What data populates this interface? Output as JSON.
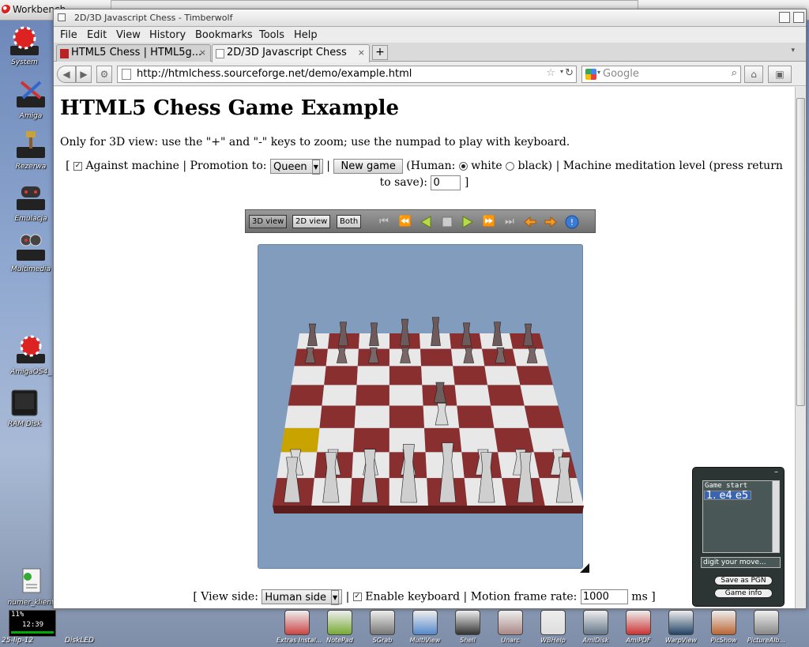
{
  "workbench": {
    "title": "Workbench",
    "ghost_window_title": "2D/3D Javascript Chess - Timberwolf"
  },
  "desktop_icons": [
    {
      "label": "System",
      "icon": "amiga-ball-drive-icon"
    },
    {
      "label": "Amiga",
      "icon": "tools-drive-icon"
    },
    {
      "label": "Rezerwa",
      "icon": "hammer-drive-icon"
    },
    {
      "label": "Emulacja",
      "icon": "gamepad-drive-icon"
    },
    {
      "label": "Multimedia",
      "icon": "film-drive-icon"
    },
    {
      "label": "AmigaOS4_",
      "icon": "amiga-ball-drive-icon"
    },
    {
      "label": "RAM Disk",
      "icon": "ram-disk-icon"
    },
    {
      "label": "numer_klient",
      "icon": "script-document-icon"
    }
  ],
  "browser": {
    "window_title": "2D/3D Javascript Chess - Timberwolf",
    "menu": [
      "File",
      "Edit",
      "View",
      "History",
      "Bookmarks",
      "Tools",
      "Help"
    ],
    "tabs": [
      {
        "label": "HTML5 Chess | HTML5g...",
        "active": false
      },
      {
        "label": "2D/3D Javascript Chess",
        "active": true
      }
    ],
    "new_tab_label": "+",
    "url": "http://htmlchess.sourceforge.net/demo/example.html",
    "search_placeholder": "Google",
    "search_engine_menu_glyph": "▾"
  },
  "page": {
    "heading": "HTML5 Chess Game Example",
    "intro": "Only for 3D view: use the \"+\" and \"-\" keys to zoom; use the numpad to play with keyboard.",
    "controls": {
      "open_bracket": "[",
      "against_machine_checked": true,
      "against_machine_label": "Against machine |",
      "promotion_label": "Promotion to:",
      "promotion_value": "Queen",
      "separator": "|",
      "new_game_label": "New game",
      "human_label": "(Human:",
      "white_label": "white",
      "white_selected": true,
      "black_label": "black) | Machine meditation level (press return to save):",
      "meditation_value": "0",
      "close_bracket": "]"
    },
    "toolbar": {
      "views": [
        "3D view",
        "2D view",
        "Both"
      ],
      "active_view": "3D view",
      "nav_icons": [
        "first-move-icon",
        "rewind-icon",
        "back-play-icon",
        "stop-icon",
        "play-icon",
        "fast-forward-icon",
        "last-move-icon",
        "undo-arrow-icon",
        "redo-arrow-icon",
        "info-icon"
      ]
    },
    "board": {
      "background_color": "#819cbd",
      "light_square": "#e8e8e8",
      "dark_square": "#8a2f2f",
      "highlight_square": "#c9a400",
      "last_move": "1. e4 e5"
    },
    "bottom": {
      "view_side_label": "[ View side:",
      "view_side_value": "Human side",
      "separator": "|",
      "enable_keyboard_checked": true,
      "enable_keyboard_label": "Enable keyboard | Motion frame rate:",
      "frame_rate_value": "1000",
      "frame_rate_unit": "ms ]"
    }
  },
  "move_window": {
    "header": "Game start",
    "moves": [
      "1. e4 e5"
    ],
    "input_placeholder": "digit your move...",
    "save_label": "Save as PGN",
    "info_label": "Game info"
  },
  "status": {
    "cpu": "11%",
    "time": "12:39",
    "date": "25-lip-12",
    "diskled": "DiskLED"
  },
  "dock": [
    {
      "label": "Extras Instal..."
    },
    {
      "label": "NotePad"
    },
    {
      "label": "SGrab"
    },
    {
      "label": "MultiView"
    },
    {
      "label": "Shell"
    },
    {
      "label": "Unarc"
    },
    {
      "label": "WBHelp"
    },
    {
      "label": "AmiDisk"
    },
    {
      "label": "AmiPDF"
    },
    {
      "label": "WarpView"
    },
    {
      "label": "PicShow"
    },
    {
      "label": "PictureAlb..."
    }
  ]
}
